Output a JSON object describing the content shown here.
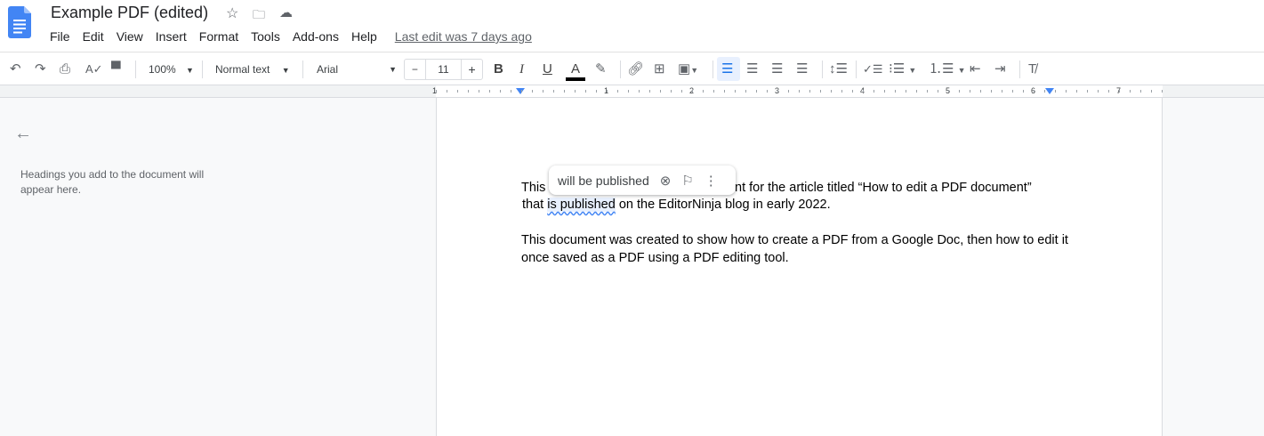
{
  "header": {
    "title": "Example PDF (edited)",
    "last_edit": "Last edit was 7 days ago",
    "menu": [
      "File",
      "Edit",
      "View",
      "Insert",
      "Format",
      "Tools",
      "Add-ons",
      "Help"
    ]
  },
  "toolbar": {
    "zoom": "100%",
    "style": "Normal text",
    "font": "Arial",
    "font_size": "11",
    "minus": "−",
    "plus": "+",
    "bold": "B",
    "italic": "I",
    "underline": "U",
    "text_color": "A"
  },
  "ruler": {
    "numbers": [
      "1",
      "1",
      "2",
      "3",
      "4",
      "5",
      "6",
      "7"
    ]
  },
  "outline": {
    "empty_text": "Headings you add to the document will appear here."
  },
  "document": {
    "p1_start": "This",
    "p1_rest": "nt for the article titled “How to edit a PDF document”",
    "p1_line2_a": "that ",
    "p1_line2_hl": "is published",
    "p1_line2_b": " on the EditorNinja blog in early 2022.",
    "p2_line1": "This document was created to show how to create a PDF from a Google Doc, then how to edit it",
    "p2_line2": "once saved as a PDF using a PDF editing tool."
  },
  "suggestion": {
    "text": "will be published"
  }
}
